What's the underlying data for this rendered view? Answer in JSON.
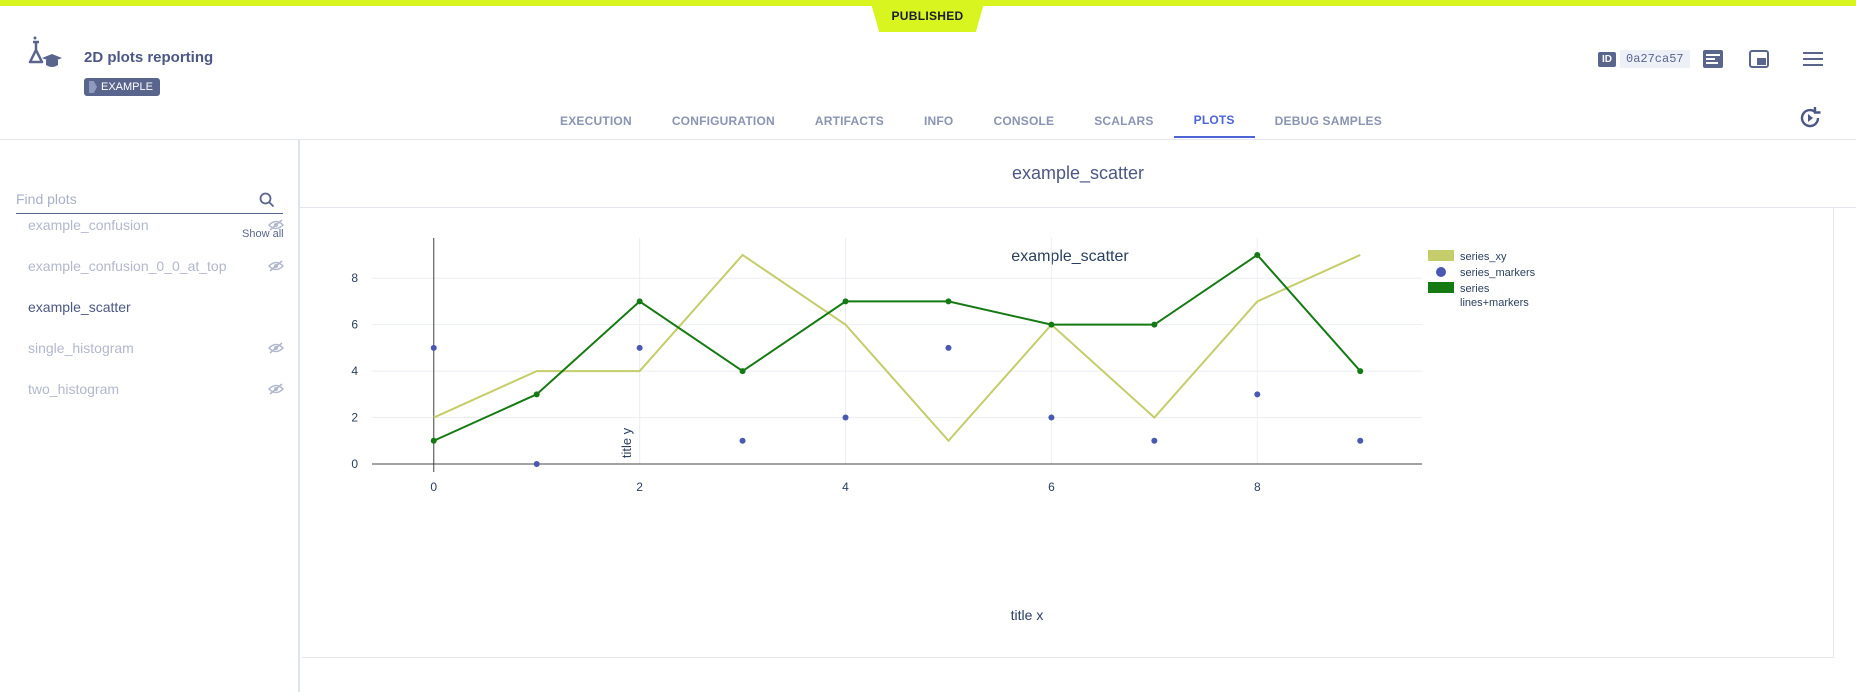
{
  "status": {
    "published": "PUBLISHED"
  },
  "header": {
    "title": "2D plots reporting",
    "tag": "EXAMPLE",
    "id_label": "ID",
    "id_value": "0a27ca57"
  },
  "tabs": [
    {
      "label": "EXECUTION"
    },
    {
      "label": "CONFIGURATION"
    },
    {
      "label": "ARTIFACTS"
    },
    {
      "label": "INFO"
    },
    {
      "label": "CONSOLE"
    },
    {
      "label": "SCALARS"
    },
    {
      "label": "PLOTS",
      "active": true
    },
    {
      "label": "DEBUG SAMPLES"
    }
  ],
  "sidebar": {
    "search_placeholder": "Find plots",
    "show_all": "Show all",
    "items": [
      {
        "label": "example_confusion",
        "hidden": true
      },
      {
        "label": "example_confusion_0_0_at_top",
        "hidden": true
      },
      {
        "label": "example_scatter",
        "hidden": false
      },
      {
        "label": "single_histogram",
        "hidden": true
      },
      {
        "label": "two_histogram",
        "hidden": true
      }
    ]
  },
  "main": {
    "section_title": "example_scatter"
  },
  "colors": {
    "accent": "#d9f51f",
    "primary": "#4c64d6",
    "series_xy": "#c5cd6a",
    "series_markers": "#4a57b3",
    "series_lines_markers": "#157a13"
  },
  "chart_data": {
    "type": "scatter",
    "title": "example_scatter",
    "xlabel": "title x",
    "ylabel": "title y",
    "xlim": [
      -0.6,
      9.6
    ],
    "ylim": [
      0,
      9.3
    ],
    "x_ticks": [
      0,
      2,
      4,
      6,
      8
    ],
    "y_ticks": [
      0,
      2,
      4,
      6,
      8
    ],
    "grid": true,
    "legend_position": "top-right",
    "series": [
      {
        "name": "series_xy",
        "mode": "lines",
        "color": "#c5cd6a",
        "x": [
          0,
          1,
          2,
          3,
          4,
          5,
          6,
          7,
          8,
          9
        ],
        "y": [
          2,
          4,
          4,
          9,
          6,
          1,
          6,
          2,
          7,
          9
        ]
      },
      {
        "name": "series_markers",
        "mode": "markers",
        "color": "#4a57b3",
        "x": [
          0,
          1,
          2,
          3,
          4,
          5,
          6,
          7,
          8,
          9
        ],
        "y": [
          5,
          0,
          5,
          1,
          2,
          5,
          2,
          1,
          3,
          1
        ]
      },
      {
        "name": "series\nlines+markers",
        "mode": "lines+markers",
        "color": "#157a13",
        "x": [
          0,
          1,
          2,
          3,
          4,
          5,
          6,
          7,
          8,
          9
        ],
        "y": [
          1,
          3,
          7,
          4,
          7,
          7,
          6,
          6,
          9,
          4
        ]
      }
    ]
  }
}
